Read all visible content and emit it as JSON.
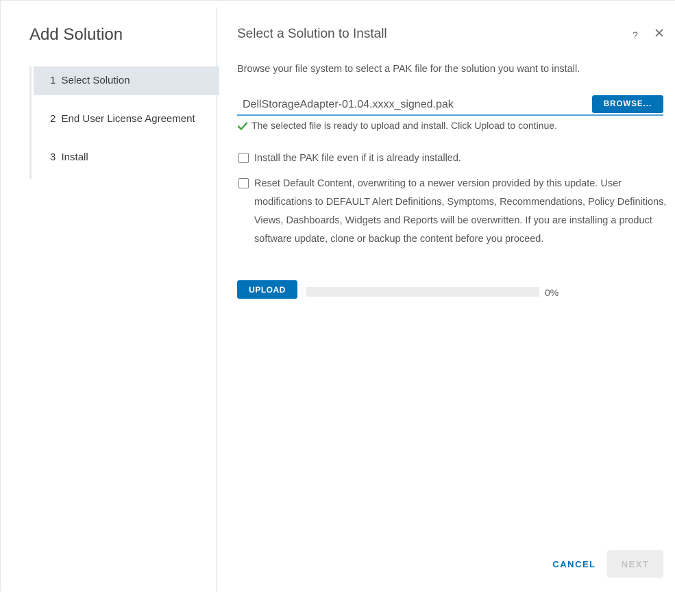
{
  "wizard": {
    "title": "Add Solution",
    "steps": [
      {
        "num": "1",
        "label": "Select Solution",
        "active": true
      },
      {
        "num": "2",
        "label": "End User License Agreement",
        "active": false
      },
      {
        "num": "3",
        "label": "Install",
        "active": false
      }
    ]
  },
  "header": {
    "title": "Select a Solution to Install",
    "help": "?",
    "close_icon": "close-icon"
  },
  "main": {
    "description": "Browse your file system to select a PAK file for the solution you want to install.",
    "file": {
      "value": "DellStorageAdapter-01.04.xxxx_signed.pak",
      "browse_label": "BROWSE..."
    },
    "status": {
      "icon": "check-icon",
      "color": "#3aa33a",
      "text": "The selected file is ready to upload and install. Click Upload to continue."
    },
    "options": [
      {
        "label": "Install the PAK file even if it is already installed.",
        "checked": false
      },
      {
        "label": "Reset Default Content, overwriting to a newer version provided by this update. User modifications to DEFAULT Alert Definitions, Symptoms, Recommendations, Policy Definitions, Views, Dashboards, Widgets and Reports will be overwritten. If you are installing a product software update, clone or backup the content before you proceed.",
        "checked": false
      }
    ],
    "upload": {
      "label": "UPLOAD",
      "progress_percent": 0,
      "progress_text": "0%"
    }
  },
  "footer": {
    "cancel_label": "CANCEL",
    "next_label": "NEXT",
    "next_enabled": false
  },
  "colors": {
    "accent": "#0072b8",
    "active_step_bg": "#e0e6ec"
  }
}
